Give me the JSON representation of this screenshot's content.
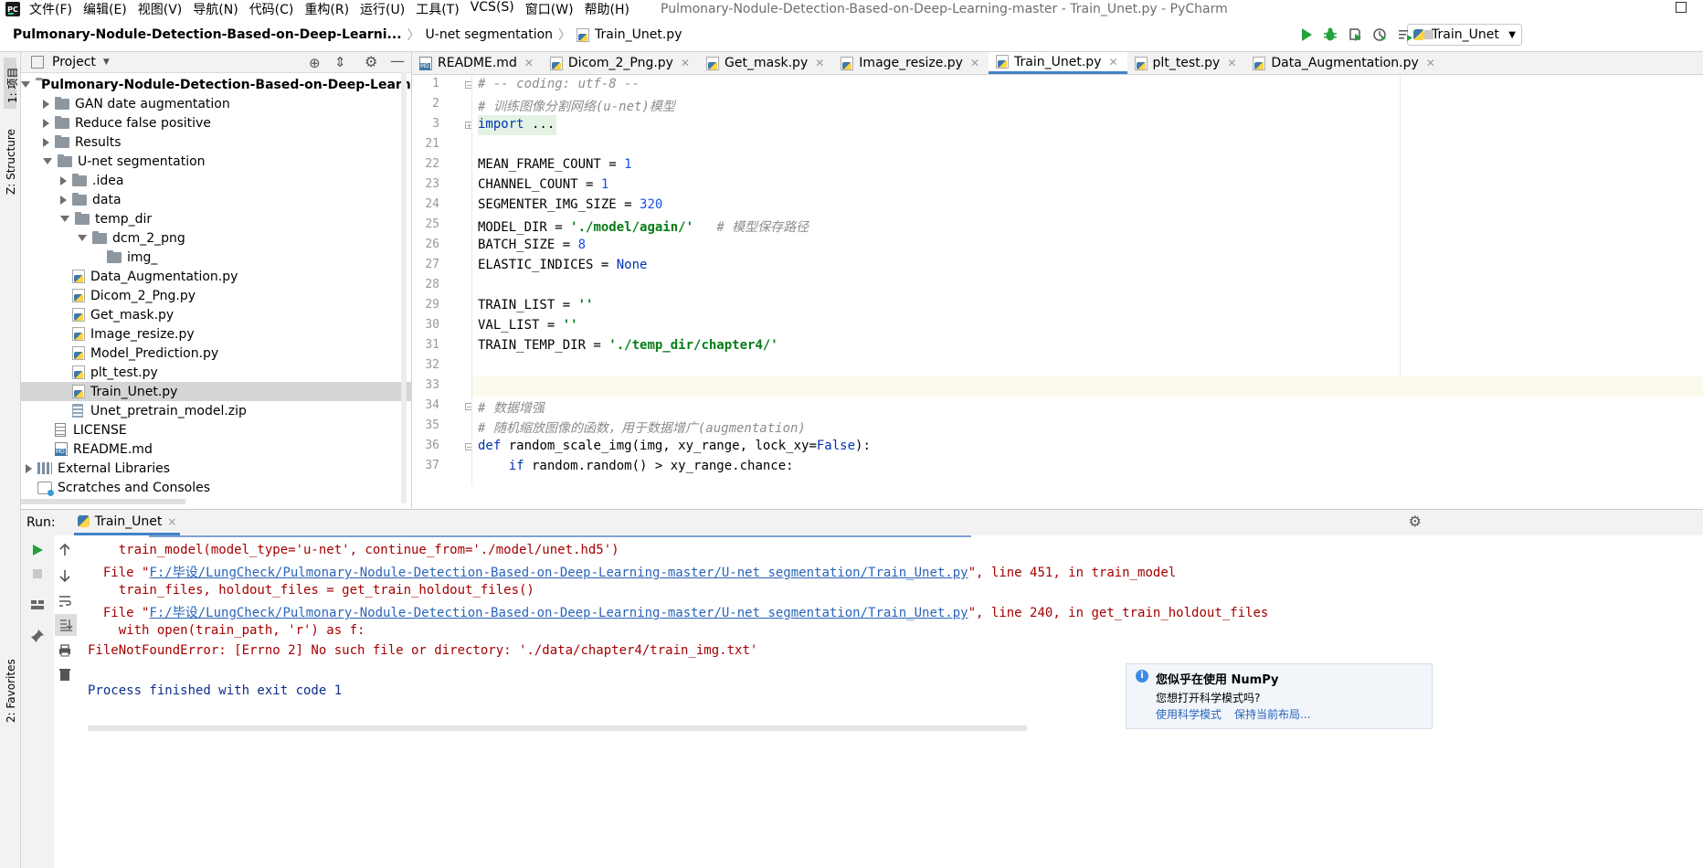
{
  "window": {
    "title": "Pulmonary-Nodule-Detection-Based-on-Deep-Learning-master - Train_Unet.py - PyCharm",
    "logo_text": "PC"
  },
  "menu": [
    "文件(F)",
    "编辑(E)",
    "视图(V)",
    "导航(N)",
    "代码(C)",
    "重构(R)",
    "运行(U)",
    "工具(T)",
    "VCS(S)",
    "窗口(W)",
    "帮助(H)"
  ],
  "breadcrumb": {
    "project": "Pulmonary-Nodule-Detection-Based-on-Deep-Learni...",
    "folder": "U-net segmentation",
    "file": "Train_Unet.py"
  },
  "run_config": {
    "label": "Train_Unet"
  },
  "sidebar_left": {
    "project_tab": "1: 项目",
    "structure_tab": "Z: Structure",
    "favorites_tab": "2: Favorites"
  },
  "project_panel": {
    "title": "Project",
    "tree": [
      {
        "label": "Pulmonary-Nodule-Detection-Based-on-Deep-Learning-ma",
        "type": "folder",
        "state": "open",
        "bold": true
      },
      {
        "label": "GAN date augmentation",
        "type": "folder",
        "state": "closed"
      },
      {
        "label": "Reduce false positive",
        "type": "folder",
        "state": "closed"
      },
      {
        "label": "Results",
        "type": "folder",
        "state": "closed"
      },
      {
        "label": "U-net segmentation",
        "type": "folder",
        "state": "open"
      },
      {
        "label": ".idea",
        "type": "folder",
        "state": "closed"
      },
      {
        "label": "data",
        "type": "folder",
        "state": "closed"
      },
      {
        "label": "temp_dir",
        "type": "folder",
        "state": "open"
      },
      {
        "label": "dcm_2_png",
        "type": "folder",
        "state": "open"
      },
      {
        "label": "img_",
        "type": "folder",
        "state": "none"
      },
      {
        "label": "Data_Augmentation.py",
        "type": "py"
      },
      {
        "label": "Dicom_2_Png.py",
        "type": "py"
      },
      {
        "label": "Get_mask.py",
        "type": "py"
      },
      {
        "label": "Image_resize.py",
        "type": "py"
      },
      {
        "label": "Model_Prediction.py",
        "type": "py"
      },
      {
        "label": "plt_test.py",
        "type": "py"
      },
      {
        "label": "Train_Unet.py",
        "type": "py",
        "selected": true
      },
      {
        "label": "Unet_pretrain_model.zip",
        "type": "zip"
      },
      {
        "label": "LICENSE",
        "type": "txt"
      },
      {
        "label": "README.md",
        "type": "md"
      },
      {
        "label": "External Libraries",
        "type": "lib",
        "state": "closed"
      },
      {
        "label": "Scratches and Consoles",
        "type": "scratch"
      }
    ]
  },
  "tabs": [
    {
      "label": "README.md",
      "type": "md"
    },
    {
      "label": "Dicom_2_Png.py",
      "type": "py"
    },
    {
      "label": "Get_mask.py",
      "type": "py"
    },
    {
      "label": "Image_resize.py",
      "type": "py"
    },
    {
      "label": "Train_Unet.py",
      "type": "py",
      "active": true
    },
    {
      "label": "plt_test.py",
      "type": "py"
    },
    {
      "label": "Data_Augmentation.py",
      "type": "py"
    }
  ],
  "editor": {
    "lines": [
      {
        "n": "1",
        "parts": [
          [
            "cm",
            "# -- coding: utf-8 --"
          ]
        ]
      },
      {
        "n": "2",
        "parts": [
          [
            "cm",
            "# 训练图像分割网络(u-net)模型"
          ]
        ]
      },
      {
        "n": "3",
        "parts": [
          [
            "kw",
            "import"
          ],
          [
            "",
            " ..."
          ]
        ]
      },
      {
        "n": "21",
        "parts": []
      },
      {
        "n": "22",
        "parts": [
          [
            "",
            "MEAN_FRAME_COUNT = "
          ],
          [
            "num",
            "1"
          ]
        ]
      },
      {
        "n": "23",
        "parts": [
          [
            "",
            "CHANNEL_COUNT = "
          ],
          [
            "num",
            "1"
          ]
        ]
      },
      {
        "n": "24",
        "parts": [
          [
            "",
            "SEGMENTER_IMG_SIZE = "
          ],
          [
            "num",
            "320"
          ]
        ]
      },
      {
        "n": "25",
        "parts": [
          [
            "",
            "MODEL_DIR = "
          ],
          [
            "str",
            "'./model/again/'"
          ],
          [
            "",
            "   "
          ],
          [
            "cm",
            "# 模型保存路径"
          ]
        ]
      },
      {
        "n": "26",
        "parts": [
          [
            "",
            "BATCH_SIZE = "
          ],
          [
            "num",
            "8"
          ]
        ]
      },
      {
        "n": "27",
        "parts": [
          [
            "",
            "ELASTIC_INDICES = "
          ],
          [
            "kw",
            "None"
          ]
        ]
      },
      {
        "n": "28",
        "parts": []
      },
      {
        "n": "29",
        "parts": [
          [
            "",
            "TRAIN_LIST = "
          ],
          [
            "str",
            "''"
          ]
        ]
      },
      {
        "n": "30",
        "parts": [
          [
            "",
            "VAL_LIST = "
          ],
          [
            "str",
            "''"
          ]
        ]
      },
      {
        "n": "31",
        "parts": [
          [
            "",
            "TRAIN_TEMP_DIR = "
          ],
          [
            "str",
            "'./temp_dir/chapter4/'"
          ]
        ]
      },
      {
        "n": "32",
        "parts": []
      },
      {
        "n": "33",
        "parts": []
      },
      {
        "n": "34",
        "parts": [
          [
            "cm",
            "# 数据增强"
          ]
        ]
      },
      {
        "n": "35",
        "parts": [
          [
            "cm",
            "# 随机缩放图像的函数，用于数据增广(augmentation)"
          ]
        ]
      },
      {
        "n": "36",
        "parts": [
          [
            "kw",
            "def"
          ],
          [
            "",
            " random_scale_img(img, xy_range, lock_xy="
          ],
          [
            "kw",
            "False"
          ],
          [
            "",
            "):"
          ]
        ]
      },
      {
        "n": "37",
        "parts": [
          [
            "",
            "    "
          ],
          [
            "kw",
            "if"
          ],
          [
            "",
            " random.random() > xy_range.chance:"
          ]
        ]
      }
    ]
  },
  "run_panel": {
    "label": "Run:",
    "tab": "Train_Unet",
    "console": [
      {
        "text": "    train_model(model_type='u-net', continue_from='./model/unet.hd5')"
      },
      {
        "pre": "  File \"",
        "link": "F:/毕设/LungCheck/Pulmonary-Nodule-Detection-Based-on-Deep-Learning-master/U-net segmentation/Train_Unet.py",
        "post": "\", line 451, in train_model"
      },
      {
        "text": "    train_files, holdout_files = get_train_holdout_files()"
      },
      {
        "pre": "  File \"",
        "link": "F:/毕设/LungCheck/Pulmonary-Nodule-Detection-Based-on-Deep-Learning-master/U-net segmentation/Train_Unet.py",
        "post": "\", line 240, in get_train_holdout_files"
      },
      {
        "text": "    with open(train_path, 'r') as f:"
      },
      {
        "text": "FileNotFoundError: [Errno 2] No such file or directory: './data/chapter4/train_img.txt'"
      },
      {
        "text": ""
      },
      {
        "text": "Process finished with exit code 1",
        "style": "blue"
      }
    ]
  },
  "notification": {
    "title": "您似乎在使用 NumPy",
    "body": "您想打开科学模式吗?",
    "link1": "使用科学模式",
    "link2": "保持当前布局..."
  },
  "colors": {
    "accent": "#4083c9",
    "error": "#a60000",
    "link": "#2a63b8",
    "run_green": "#21a33b"
  }
}
